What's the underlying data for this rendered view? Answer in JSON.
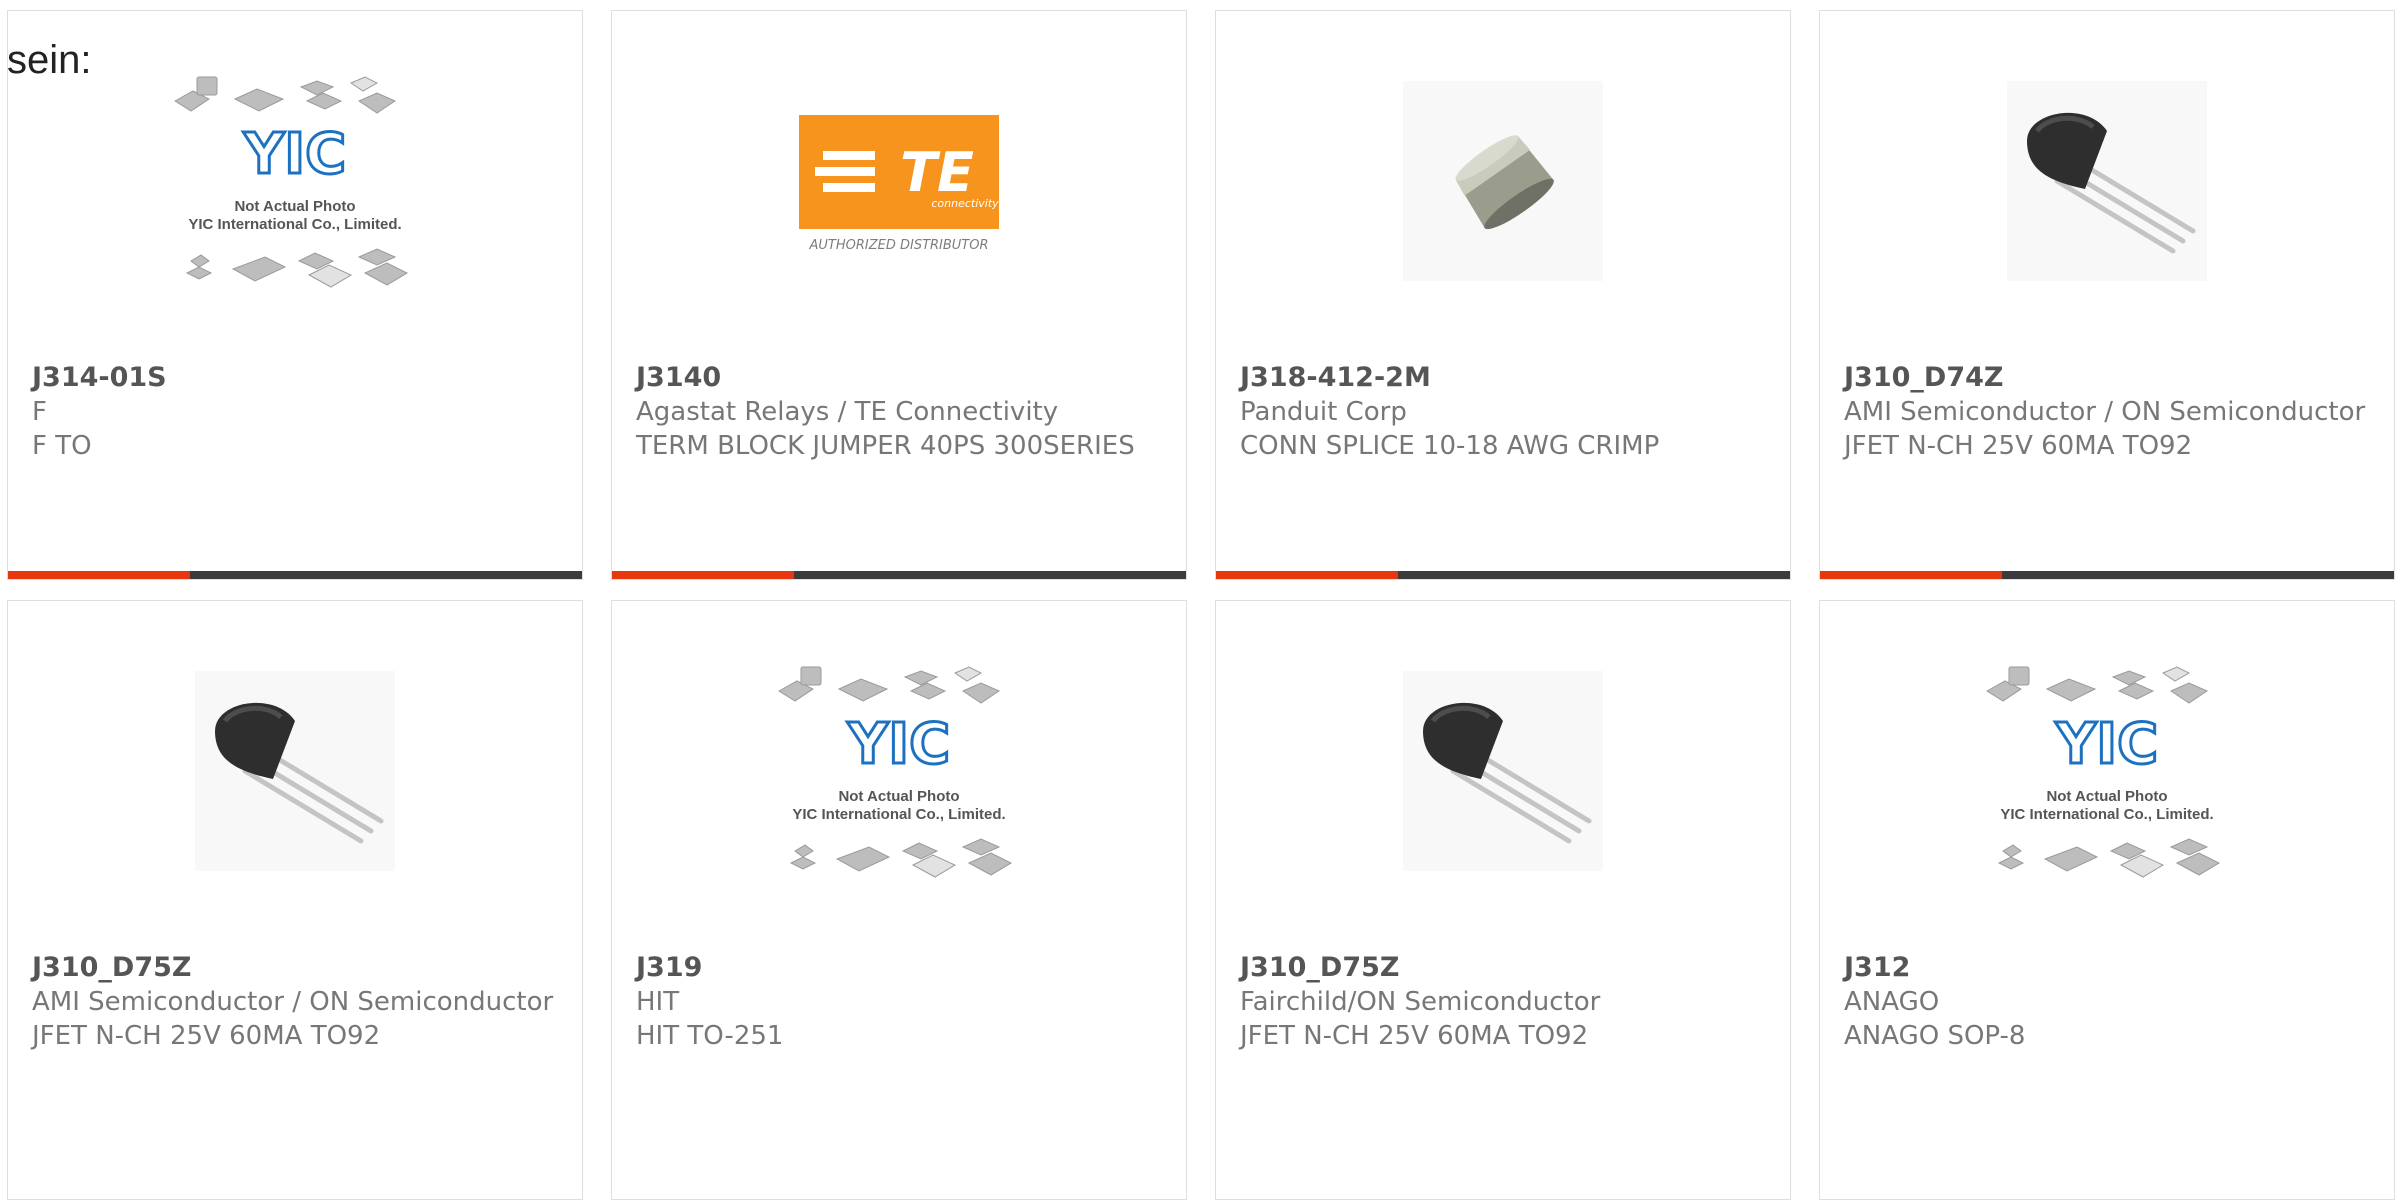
{
  "intro_text": "sein:",
  "colors": {
    "accent": "#e8360f",
    "bar": "#3b3b3b",
    "te_orange": "#f7941d"
  },
  "products": [
    {
      "part_number": "J314-01S",
      "manufacturer": "F",
      "description": "F TO",
      "image": "yic-placeholder"
    },
    {
      "part_number": "J3140",
      "manufacturer": "Agastat Relays / TE Connectivity",
      "description": "TERM BLOCK JUMPER 40PS 300SERIES",
      "image": "te-logo"
    },
    {
      "part_number": "J318-412-2M",
      "manufacturer": "Panduit Corp",
      "description": "CONN SPLICE 10-18 AWG CRIMP",
      "image": "splice"
    },
    {
      "part_number": "J310_D74Z",
      "manufacturer": "AMI Semiconductor / ON Semiconductor",
      "description": "JFET N-CH 25V 60MA TO92",
      "image": "to92"
    },
    {
      "part_number": "J310_D75Z",
      "manufacturer": "AMI Semiconductor / ON Semiconductor",
      "description": "JFET N-CH 25V 60MA TO92",
      "image": "to92"
    },
    {
      "part_number": "J319",
      "manufacturer": "HIT",
      "description": "HIT TO-251",
      "image": "yic-placeholder"
    },
    {
      "part_number": "J310_D75Z",
      "manufacturer": "Fairchild/ON Semiconductor",
      "description": "JFET N-CH 25V 60MA TO92",
      "image": "to92"
    },
    {
      "part_number": "J312",
      "manufacturer": "ANAGO",
      "description": "ANAGO SOP-8",
      "image": "yic-placeholder"
    }
  ],
  "yic": {
    "logo_text": "YIC",
    "line1": "Not Actual Photo",
    "line2": "YIC International Co., Limited."
  },
  "te": {
    "logo_text": "TE",
    "sub_text": "connectivity",
    "distributor_text": "AUTHORIZED DISTRIBUTOR"
  }
}
